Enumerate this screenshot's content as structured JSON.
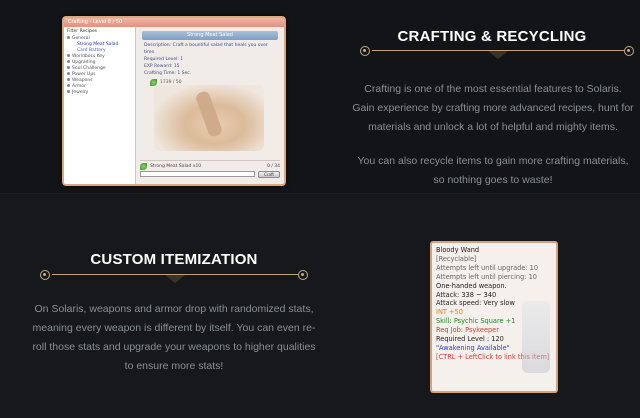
{
  "crafting": {
    "title": "CRAFTING & RECYCLING",
    "paragraph1": "Crafting is one of the most essential features to Solaris. Gain experience by crafting more advanced recipes, hunt for materials and unlock a lot of helpful and mighty items.",
    "paragraph2": "You can also recycle items to gain more crafting materials, so nothing goes to waste!",
    "window": {
      "title": "Crafting - Level 8 / 50",
      "filter_header": "Filter Recipes",
      "categories": [
        {
          "label": "General"
        },
        {
          "label": "Strong Meat Salad",
          "sub": true,
          "selected": true
        },
        {
          "label": "Card Battery",
          "sub": true
        },
        {
          "label": "Worldboss Key"
        },
        {
          "label": "Upgrading"
        },
        {
          "label": "Soul Challenge"
        },
        {
          "label": "Power Ups"
        },
        {
          "label": "Weapons"
        },
        {
          "label": "Armor"
        },
        {
          "label": "Jewelry"
        }
      ],
      "recipe_name": "Strong Meat Salad",
      "description": "Description: Craft a bountiful salad that heals you over time.",
      "required_level": "Required Level: 1",
      "exp_reward": "EXP Reward: 15",
      "crafting_time": "Crafting Time: 1 Sec.",
      "material_count": "1739 / 50",
      "output_label": "Strong Meat Salad x10",
      "output_qty": "0 / 34",
      "craft_button": "Craft"
    }
  },
  "itemization": {
    "title": "CUSTOM ITEMIZATION",
    "paragraph": "On Solaris, weapons and armor drop with randomized stats, meaning every weapon is different by itself. You can even re-roll those stats and upgrade your weapons to higher qualities to ensure more stats!",
    "tooltip": {
      "name": "Bloody Wand",
      "recyclable": "[Recyclable]",
      "upgrade_attempts": "Attempts left until upgrade: 10",
      "piercing_attempts": "Attempts left until piercing: 10",
      "weapon_type": "One-handed weapon.",
      "attack": "Attack: 338 ~ 340",
      "attack_speed": "Attack speed: Very slow",
      "int_bonus": "INT +50",
      "skill": "Skill: Psychic Square +1",
      "req_job": "Req Job: Psykeeper",
      "required_level": "Required Level : 120",
      "awakening": "\"Awakening Available\"",
      "ctrl_hint": "[CTRL + LeftClick to link this item]"
    }
  },
  "colors": {
    "accent_gold": "#c9ab76",
    "background": "#121417",
    "text_muted": "#8a8f96"
  }
}
